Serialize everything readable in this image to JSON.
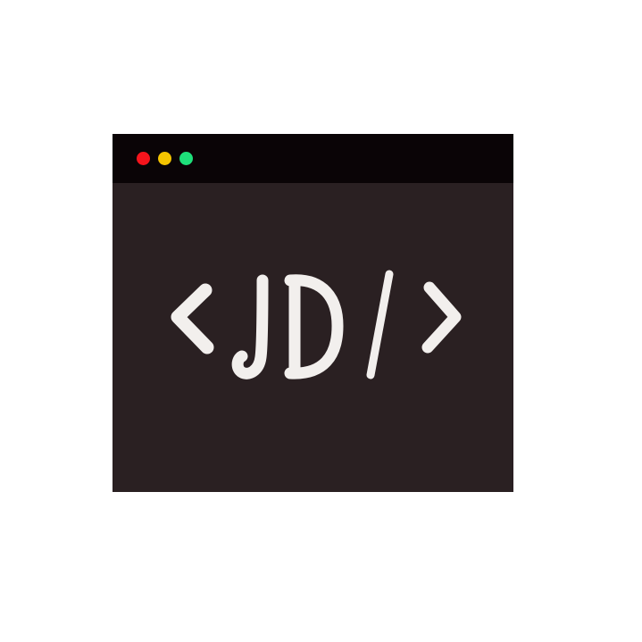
{
  "window": {
    "controls": [
      {
        "name": "close",
        "color": "#f5141c"
      },
      {
        "name": "minimize",
        "color": "#f4c400"
      },
      {
        "name": "maximize",
        "color": "#1ee07a"
      }
    ]
  },
  "logo": {
    "text": "<JD/>",
    "color": "#f2efed"
  }
}
